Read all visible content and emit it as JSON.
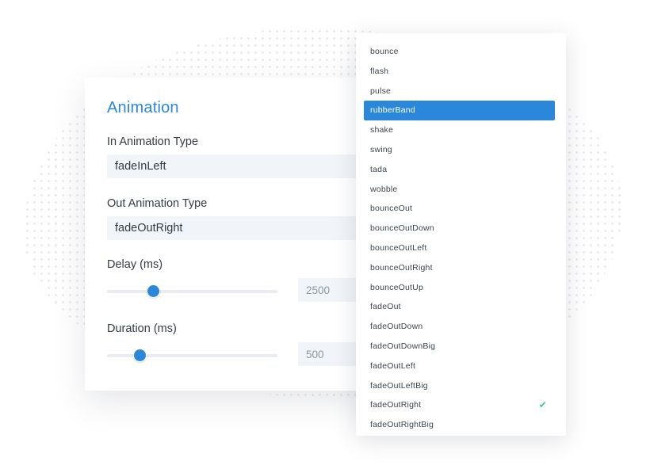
{
  "panel": {
    "title": "Animation",
    "in_animation": {
      "label": "In Animation Type",
      "value": "fadeInLeft"
    },
    "out_animation": {
      "label": "Out Animation Type",
      "value": "fadeOutRight"
    },
    "delay": {
      "label": "Delay (ms)",
      "value": "2500",
      "slider_level": 0.27
    },
    "duration": {
      "label": "Duration (ms)",
      "value": "500",
      "slider_level": 0.19
    }
  },
  "dropdown": {
    "items": [
      "bounce",
      "flash",
      "pulse",
      "rubberBand",
      "shake",
      "swing",
      "tada",
      "wobble",
      "bounceOut",
      "bounceOutDown",
      "bounceOutLeft",
      "bounceOutRight",
      "bounceOutUp",
      "fadeOut",
      "fadeOutDown",
      "fadeOutDownBig",
      "fadeOutLeft",
      "fadeOutLeftBig",
      "fadeOutRight",
      "fadeOutRightBig"
    ],
    "highlighted": "rubberBand",
    "selected": "fadeOutRight",
    "check_icon": "check-icon"
  },
  "colors": {
    "accent": "#2b87da",
    "check": "#3fbf9f",
    "field_bg": "#f1f5f9"
  }
}
